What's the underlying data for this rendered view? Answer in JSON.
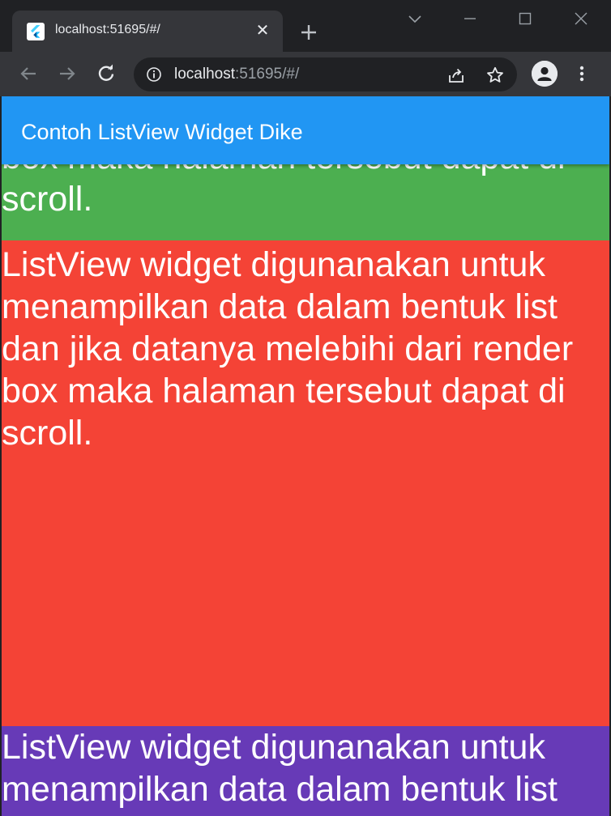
{
  "browser": {
    "tab_title": "localhost:51695/#/",
    "url_host": "localhost",
    "url_rest": ":51695/#/"
  },
  "app": {
    "title": "Contoh ListView Widget Dike"
  },
  "list": {
    "items": [
      {
        "color": "#4caf50",
        "text": "ListView widget digunanakan untuk menampilkan data dalam bentuk list dan jika datanya melebihi dari render box maka halaman tersebut dapat di scroll."
      },
      {
        "color": "#f44336",
        "text": "ListView widget digunanakan untuk menampilkan data dalam bentuk list dan jika datanya melebihi dari render box maka halaman tersebut dapat di scroll."
      },
      {
        "color": "#673ab7",
        "text": "ListView widget digunanakan untuk menampilkan data dalam bentuk list"
      }
    ]
  }
}
